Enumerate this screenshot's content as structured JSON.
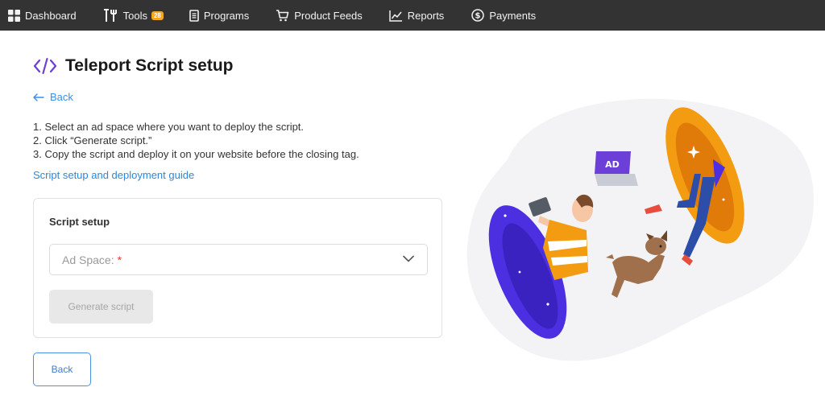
{
  "nav": {
    "items": [
      {
        "label": "Dashboard",
        "icon": "dashboard-grid-icon"
      },
      {
        "label": "Tools",
        "icon": "tools-icon",
        "badge": "28"
      },
      {
        "label": "Programs",
        "icon": "document-icon"
      },
      {
        "label": "Product Feeds",
        "icon": "cart-icon"
      },
      {
        "label": "Reports",
        "icon": "chart-line-icon"
      },
      {
        "label": "Payments",
        "icon": "dollar-circle-icon"
      }
    ]
  },
  "page": {
    "title": "Teleport Script setup",
    "back_link": "Back",
    "steps": [
      "1. Select an ad space where you want to deploy the script.",
      "2. Click “Generate script.”",
      "3. Copy the script and deploy it on your website before the closing tag."
    ],
    "guide_link": "Script setup and deployment guide"
  },
  "card": {
    "title": "Script setup",
    "ad_space_label": "Ad Space:",
    "required_mark": "*",
    "generate_button": "Generate script"
  },
  "footer": {
    "back_button": "Back"
  },
  "illustration": {
    "laptop_logo": "AD"
  },
  "colors": {
    "nav_bg": "#333333",
    "link": "#2f86d8",
    "accent_purple": "#6c3fd8",
    "badge": "#f5a623",
    "portal_blue": "#4b2fe0",
    "portal_orange": "#f39c12"
  }
}
